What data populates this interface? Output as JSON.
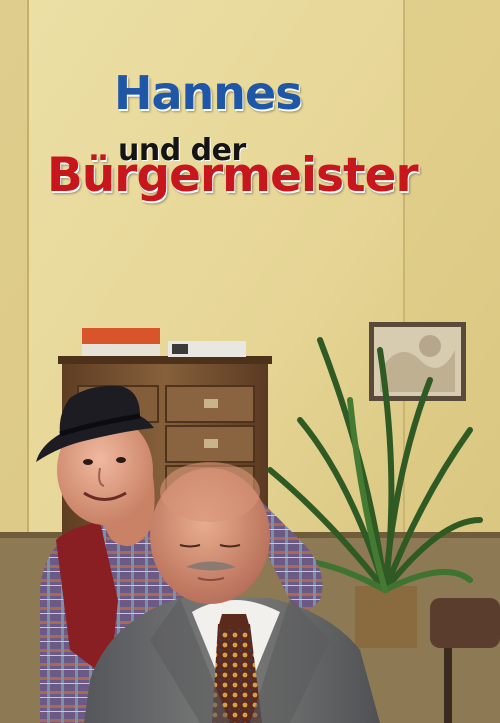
{
  "poster": {
    "title_line1": "Hannes",
    "title_line2": "und der",
    "title_line3": "Bürgermeister"
  },
  "colors": {
    "wall": "#e6d595",
    "title_blue": "#1f57a8",
    "title_red": "#c8161d",
    "cabinet": "#7a5232",
    "suit": "#6e6f6d"
  },
  "scene_elements": {
    "cabinet": "wooden-filing-cabinet",
    "plant": "potted-palm-plant",
    "frame": "framed-picture",
    "chair": "office-chair"
  }
}
